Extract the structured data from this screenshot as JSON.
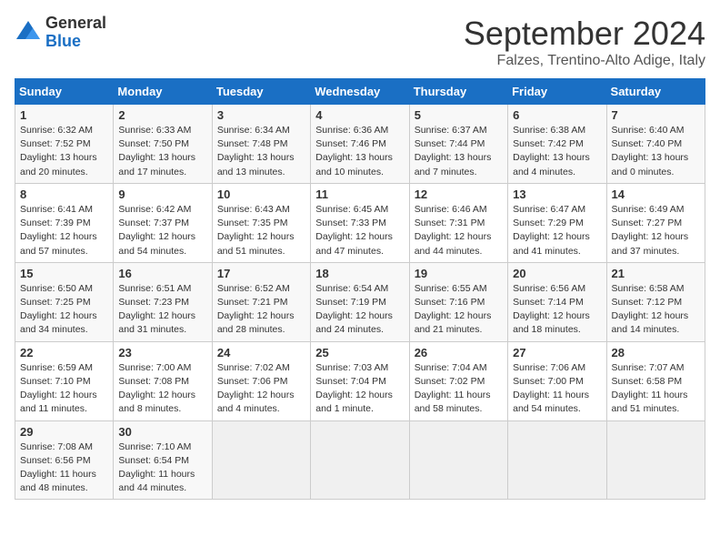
{
  "header": {
    "logo": {
      "general": "General",
      "blue": "Blue"
    },
    "title": "September 2024",
    "subtitle": "Falzes, Trentino-Alto Adige, Italy"
  },
  "columns": [
    "Sunday",
    "Monday",
    "Tuesday",
    "Wednesday",
    "Thursday",
    "Friday",
    "Saturday"
  ],
  "weeks": [
    [
      {
        "day": "1",
        "sunrise": "6:32 AM",
        "sunset": "7:52 PM",
        "daylight": "13 hours and 20 minutes"
      },
      {
        "day": "2",
        "sunrise": "6:33 AM",
        "sunset": "7:50 PM",
        "daylight": "13 hours and 17 minutes"
      },
      {
        "day": "3",
        "sunrise": "6:34 AM",
        "sunset": "7:48 PM",
        "daylight": "13 hours and 13 minutes"
      },
      {
        "day": "4",
        "sunrise": "6:36 AM",
        "sunset": "7:46 PM",
        "daylight": "13 hours and 10 minutes"
      },
      {
        "day": "5",
        "sunrise": "6:37 AM",
        "sunset": "7:44 PM",
        "daylight": "13 hours and 7 minutes"
      },
      {
        "day": "6",
        "sunrise": "6:38 AM",
        "sunset": "7:42 PM",
        "daylight": "13 hours and 4 minutes"
      },
      {
        "day": "7",
        "sunrise": "6:40 AM",
        "sunset": "7:40 PM",
        "daylight": "13 hours and 0 minutes"
      }
    ],
    [
      {
        "day": "8",
        "sunrise": "6:41 AM",
        "sunset": "7:39 PM",
        "daylight": "12 hours and 57 minutes"
      },
      {
        "day": "9",
        "sunrise": "6:42 AM",
        "sunset": "7:37 PM",
        "daylight": "12 hours and 54 minutes"
      },
      {
        "day": "10",
        "sunrise": "6:43 AM",
        "sunset": "7:35 PM",
        "daylight": "12 hours and 51 minutes"
      },
      {
        "day": "11",
        "sunrise": "6:45 AM",
        "sunset": "7:33 PM",
        "daylight": "12 hours and 47 minutes"
      },
      {
        "day": "12",
        "sunrise": "6:46 AM",
        "sunset": "7:31 PM",
        "daylight": "12 hours and 44 minutes"
      },
      {
        "day": "13",
        "sunrise": "6:47 AM",
        "sunset": "7:29 PM",
        "daylight": "12 hours and 41 minutes"
      },
      {
        "day": "14",
        "sunrise": "6:49 AM",
        "sunset": "7:27 PM",
        "daylight": "12 hours and 37 minutes"
      }
    ],
    [
      {
        "day": "15",
        "sunrise": "6:50 AM",
        "sunset": "7:25 PM",
        "daylight": "12 hours and 34 minutes"
      },
      {
        "day": "16",
        "sunrise": "6:51 AM",
        "sunset": "7:23 PM",
        "daylight": "12 hours and 31 minutes"
      },
      {
        "day": "17",
        "sunrise": "6:52 AM",
        "sunset": "7:21 PM",
        "daylight": "12 hours and 28 minutes"
      },
      {
        "day": "18",
        "sunrise": "6:54 AM",
        "sunset": "7:19 PM",
        "daylight": "12 hours and 24 minutes"
      },
      {
        "day": "19",
        "sunrise": "6:55 AM",
        "sunset": "7:16 PM",
        "daylight": "12 hours and 21 minutes"
      },
      {
        "day": "20",
        "sunrise": "6:56 AM",
        "sunset": "7:14 PM",
        "daylight": "12 hours and 18 minutes"
      },
      {
        "day": "21",
        "sunrise": "6:58 AM",
        "sunset": "7:12 PM",
        "daylight": "12 hours and 14 minutes"
      }
    ],
    [
      {
        "day": "22",
        "sunrise": "6:59 AM",
        "sunset": "7:10 PM",
        "daylight": "12 hours and 11 minutes"
      },
      {
        "day": "23",
        "sunrise": "7:00 AM",
        "sunset": "7:08 PM",
        "daylight": "12 hours and 8 minutes"
      },
      {
        "day": "24",
        "sunrise": "7:02 AM",
        "sunset": "7:06 PM",
        "daylight": "12 hours and 4 minutes"
      },
      {
        "day": "25",
        "sunrise": "7:03 AM",
        "sunset": "7:04 PM",
        "daylight": "12 hours and 1 minute"
      },
      {
        "day": "26",
        "sunrise": "7:04 AM",
        "sunset": "7:02 PM",
        "daylight": "11 hours and 58 minutes"
      },
      {
        "day": "27",
        "sunrise": "7:06 AM",
        "sunset": "7:00 PM",
        "daylight": "11 hours and 54 minutes"
      },
      {
        "day": "28",
        "sunrise": "7:07 AM",
        "sunset": "6:58 PM",
        "daylight": "11 hours and 51 minutes"
      }
    ],
    [
      {
        "day": "29",
        "sunrise": "7:08 AM",
        "sunset": "6:56 PM",
        "daylight": "11 hours and 48 minutes"
      },
      {
        "day": "30",
        "sunrise": "7:10 AM",
        "sunset": "6:54 PM",
        "daylight": "11 hours and 44 minutes"
      },
      null,
      null,
      null,
      null,
      null
    ]
  ]
}
